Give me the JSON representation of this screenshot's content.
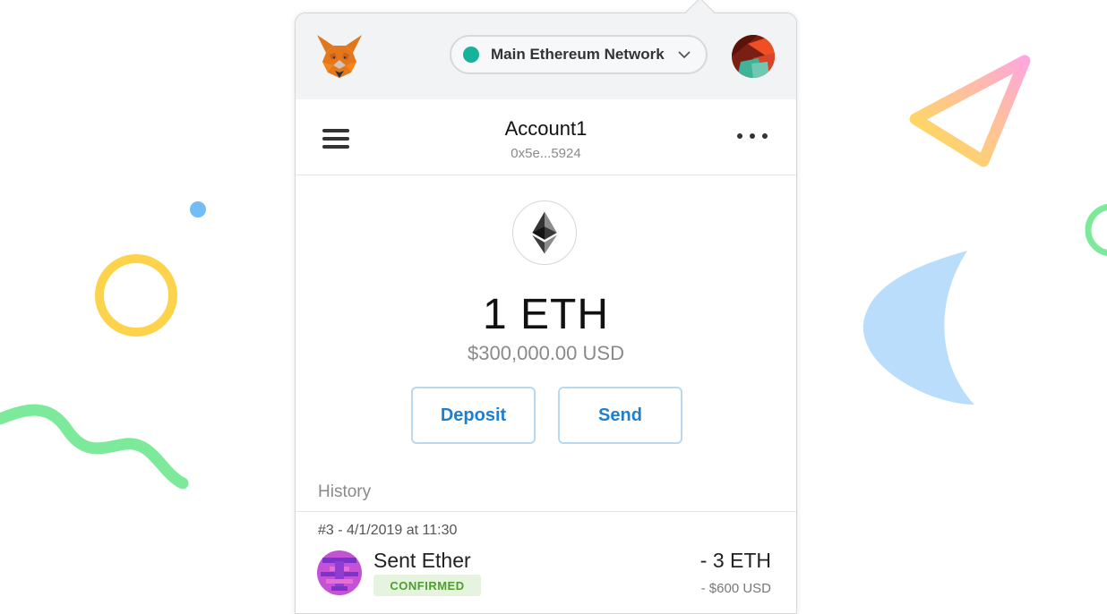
{
  "header": {
    "network_name": "Main Ethereum Network",
    "network_color": "#17b399"
  },
  "account": {
    "name": "Account1",
    "address": "0x5e...5924"
  },
  "balance": {
    "amount": "1 ETH",
    "fiat": "$300,000.00 USD",
    "deposit_label": "Deposit",
    "send_label": "Send"
  },
  "history": {
    "label": "History",
    "items": [
      {
        "meta": "#3 - 4/1/2019 at 11:30",
        "title": "Sent Ether",
        "status": "CONFIRMED",
        "amount": "- 3 ETH",
        "fiat": "- $600 USD"
      }
    ]
  },
  "icons": {
    "logo": "metamask-fox-icon",
    "avatar": "account-identicon",
    "menu": "hamburger-icon",
    "more": "more-options-icon",
    "token": "ethereum-icon"
  },
  "colors": {
    "accent": "#1f7fcf",
    "button_border": "#b7d9f3",
    "confirmed_bg": "#e6f4df",
    "confirmed_text": "#4d9e2f"
  }
}
